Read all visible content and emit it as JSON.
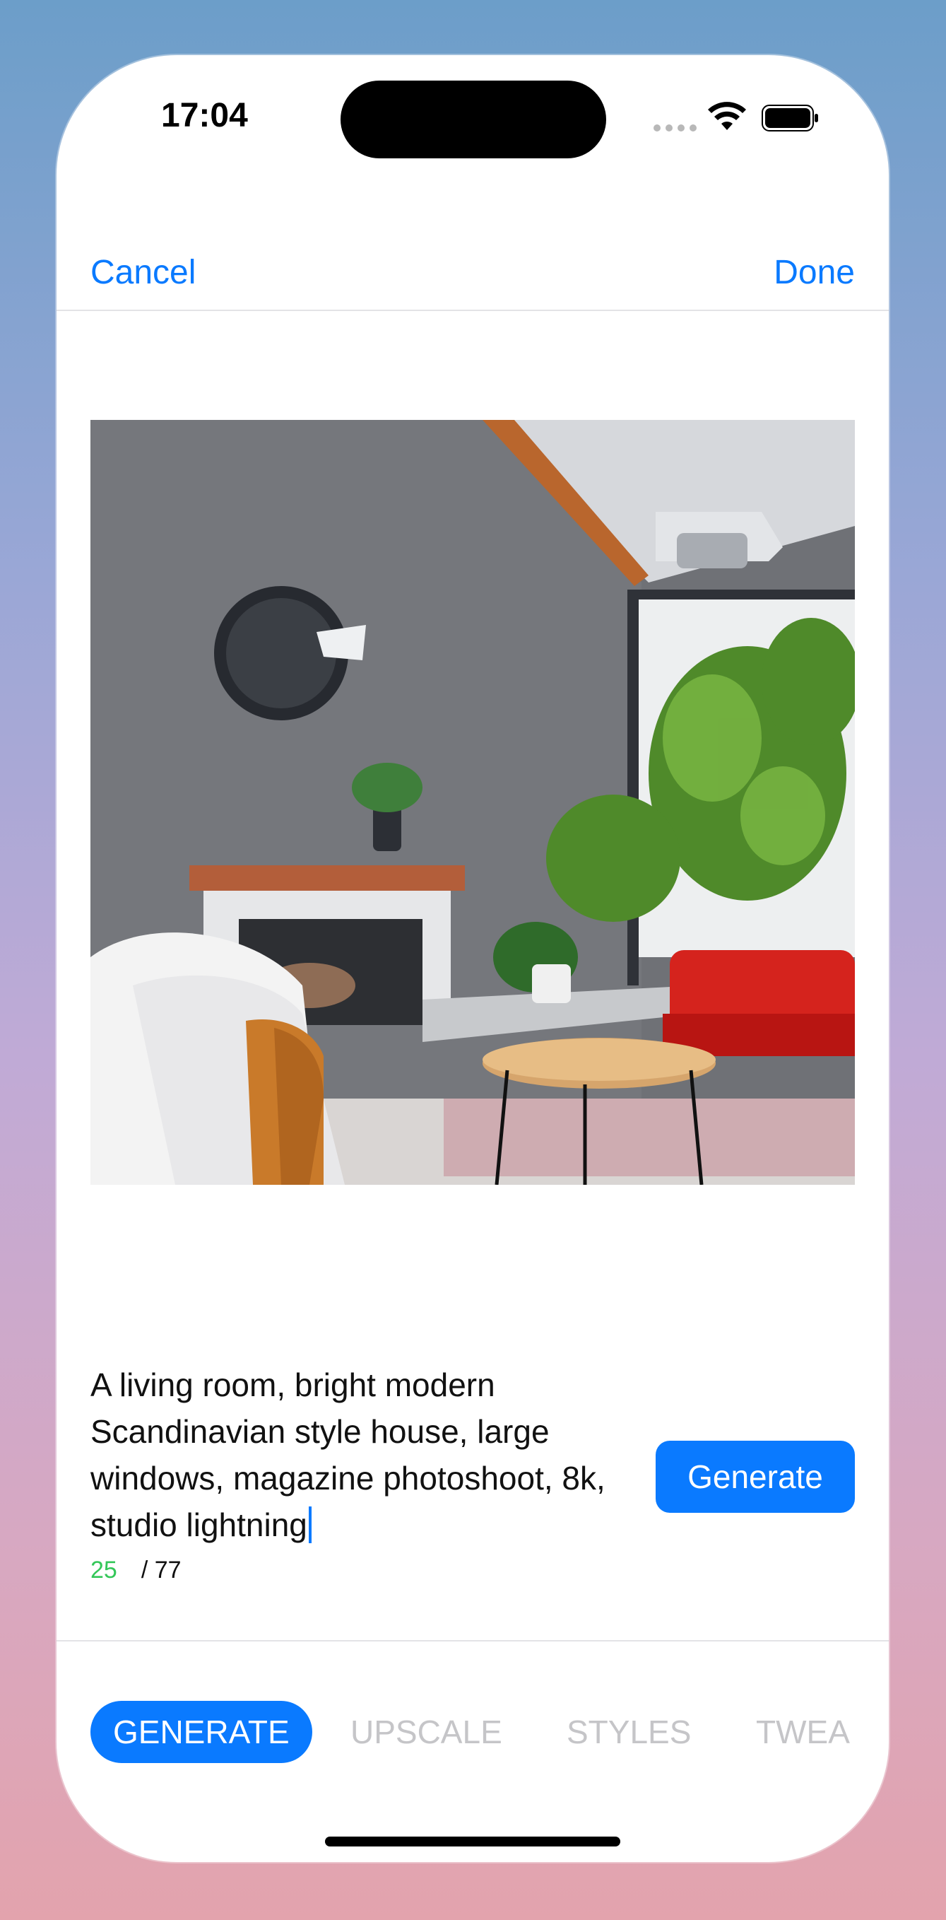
{
  "status_bar": {
    "time": "17:04"
  },
  "nav": {
    "cancel_label": "Cancel",
    "done_label": "Done"
  },
  "image": {
    "description_icon": "generated-image"
  },
  "prompt": {
    "text": "A living room, bright modern Scandinavian style house, large windows, magazine photoshoot, 8k, studio lightning",
    "count_used": "25",
    "count_total": "/ 77"
  },
  "generate_button": {
    "label": "Generate"
  },
  "tabs": [
    {
      "label": "GENERATE",
      "active": true
    },
    {
      "label": "UPSCALE",
      "active": false
    },
    {
      "label": "STYLES",
      "active": false
    },
    {
      "label": "TWEA",
      "active": false
    }
  ],
  "colors": {
    "accent": "#0a7aff",
    "counter_green": "#34c759",
    "inactive_tab": "#c5c5c8"
  }
}
